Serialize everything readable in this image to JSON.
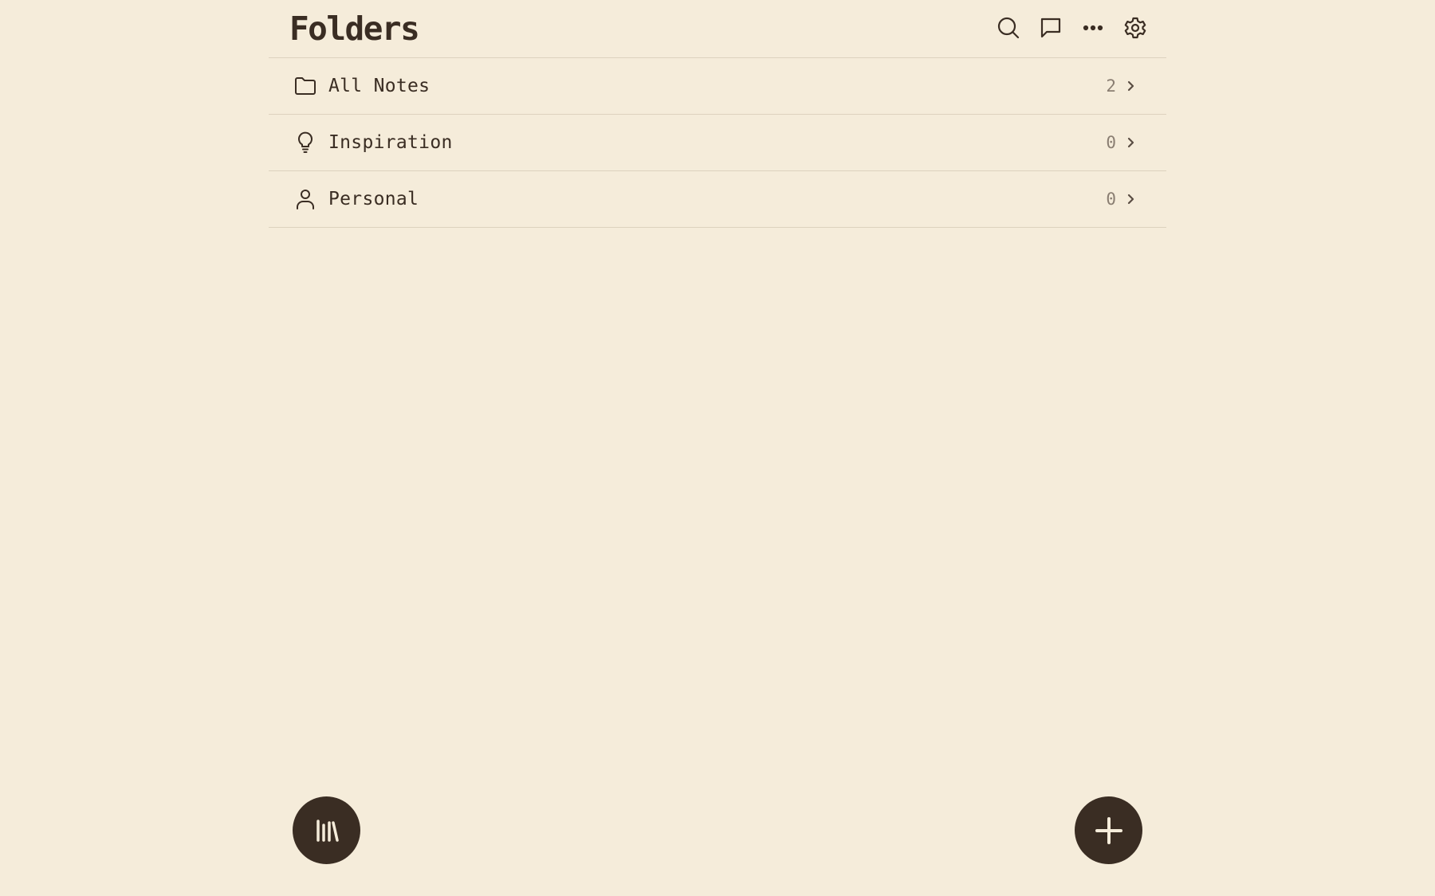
{
  "header": {
    "title": "Folders",
    "actions": [
      {
        "name": "search-icon"
      },
      {
        "name": "chat-icon"
      },
      {
        "name": "more-icon"
      },
      {
        "name": "settings-icon"
      }
    ]
  },
  "folders": [
    {
      "label": "All Notes",
      "count": "2",
      "icon": "folder-icon"
    },
    {
      "label": "Inspiration",
      "count": "0",
      "icon": "lightbulb-icon"
    },
    {
      "label": "Personal",
      "count": "0",
      "icon": "person-icon"
    }
  ],
  "fabs": {
    "library": {
      "icon": "library-icon"
    },
    "add": {
      "icon": "plus-icon"
    }
  },
  "colors": {
    "background": "#f5ecda",
    "text": "#3a2d23",
    "muted": "#8a7e72",
    "divider": "#ddd2be",
    "fab": "#3a2d23"
  }
}
